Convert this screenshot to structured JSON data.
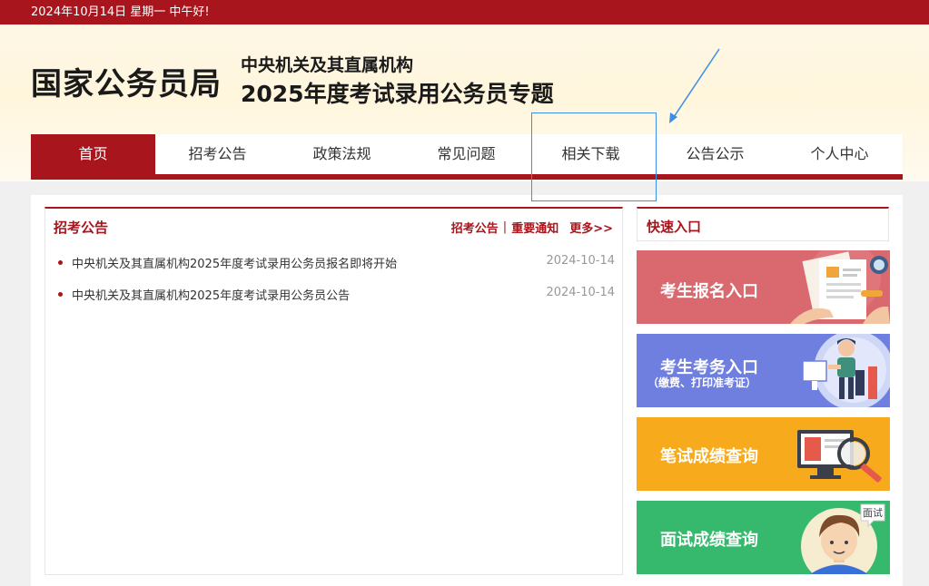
{
  "topbar": {
    "greeting": "2024年10月14日  星期一  中午好!"
  },
  "header": {
    "site_title": "国家公务员局",
    "subtitle_line1": "中央机关及其直属机构",
    "subtitle_line2": "2025年度考试录用公务员专题"
  },
  "nav": {
    "items": [
      {
        "label": "首页",
        "active": true
      },
      {
        "label": "招考公告"
      },
      {
        "label": "政策法规"
      },
      {
        "label": "常见问题"
      },
      {
        "label": "相关下载"
      },
      {
        "label": "公告公示"
      },
      {
        "label": "个人中心"
      }
    ]
  },
  "news": {
    "title": "招考公告",
    "link1": "招考公告",
    "separator": "|",
    "link2": "重要通知",
    "more": "更多>>",
    "items": [
      {
        "text": "中央机关及其直属机构2025年度考试录用公务员报名即将开始",
        "date": "2024-10-14"
      },
      {
        "text": "中央机关及其直属机构2025年度考试录用公务员公告",
        "date": "2024-10-14"
      }
    ]
  },
  "quick": {
    "title": "快速入口",
    "buttons": [
      {
        "label": "考生报名入口",
        "color": "#d9696e"
      },
      {
        "label": "考生考务入口",
        "sublabel": "（缴费、打印准考证）",
        "color": "#6f7fe0"
      },
      {
        "label": "笔试成绩查询",
        "color": "#f7ab1c"
      },
      {
        "label": "面试成绩查询",
        "badge": "面试",
        "color": "#36b96d"
      }
    ]
  },
  "colors": {
    "brand_red": "#a8151c",
    "annotation_blue": "#3b8fe4"
  }
}
